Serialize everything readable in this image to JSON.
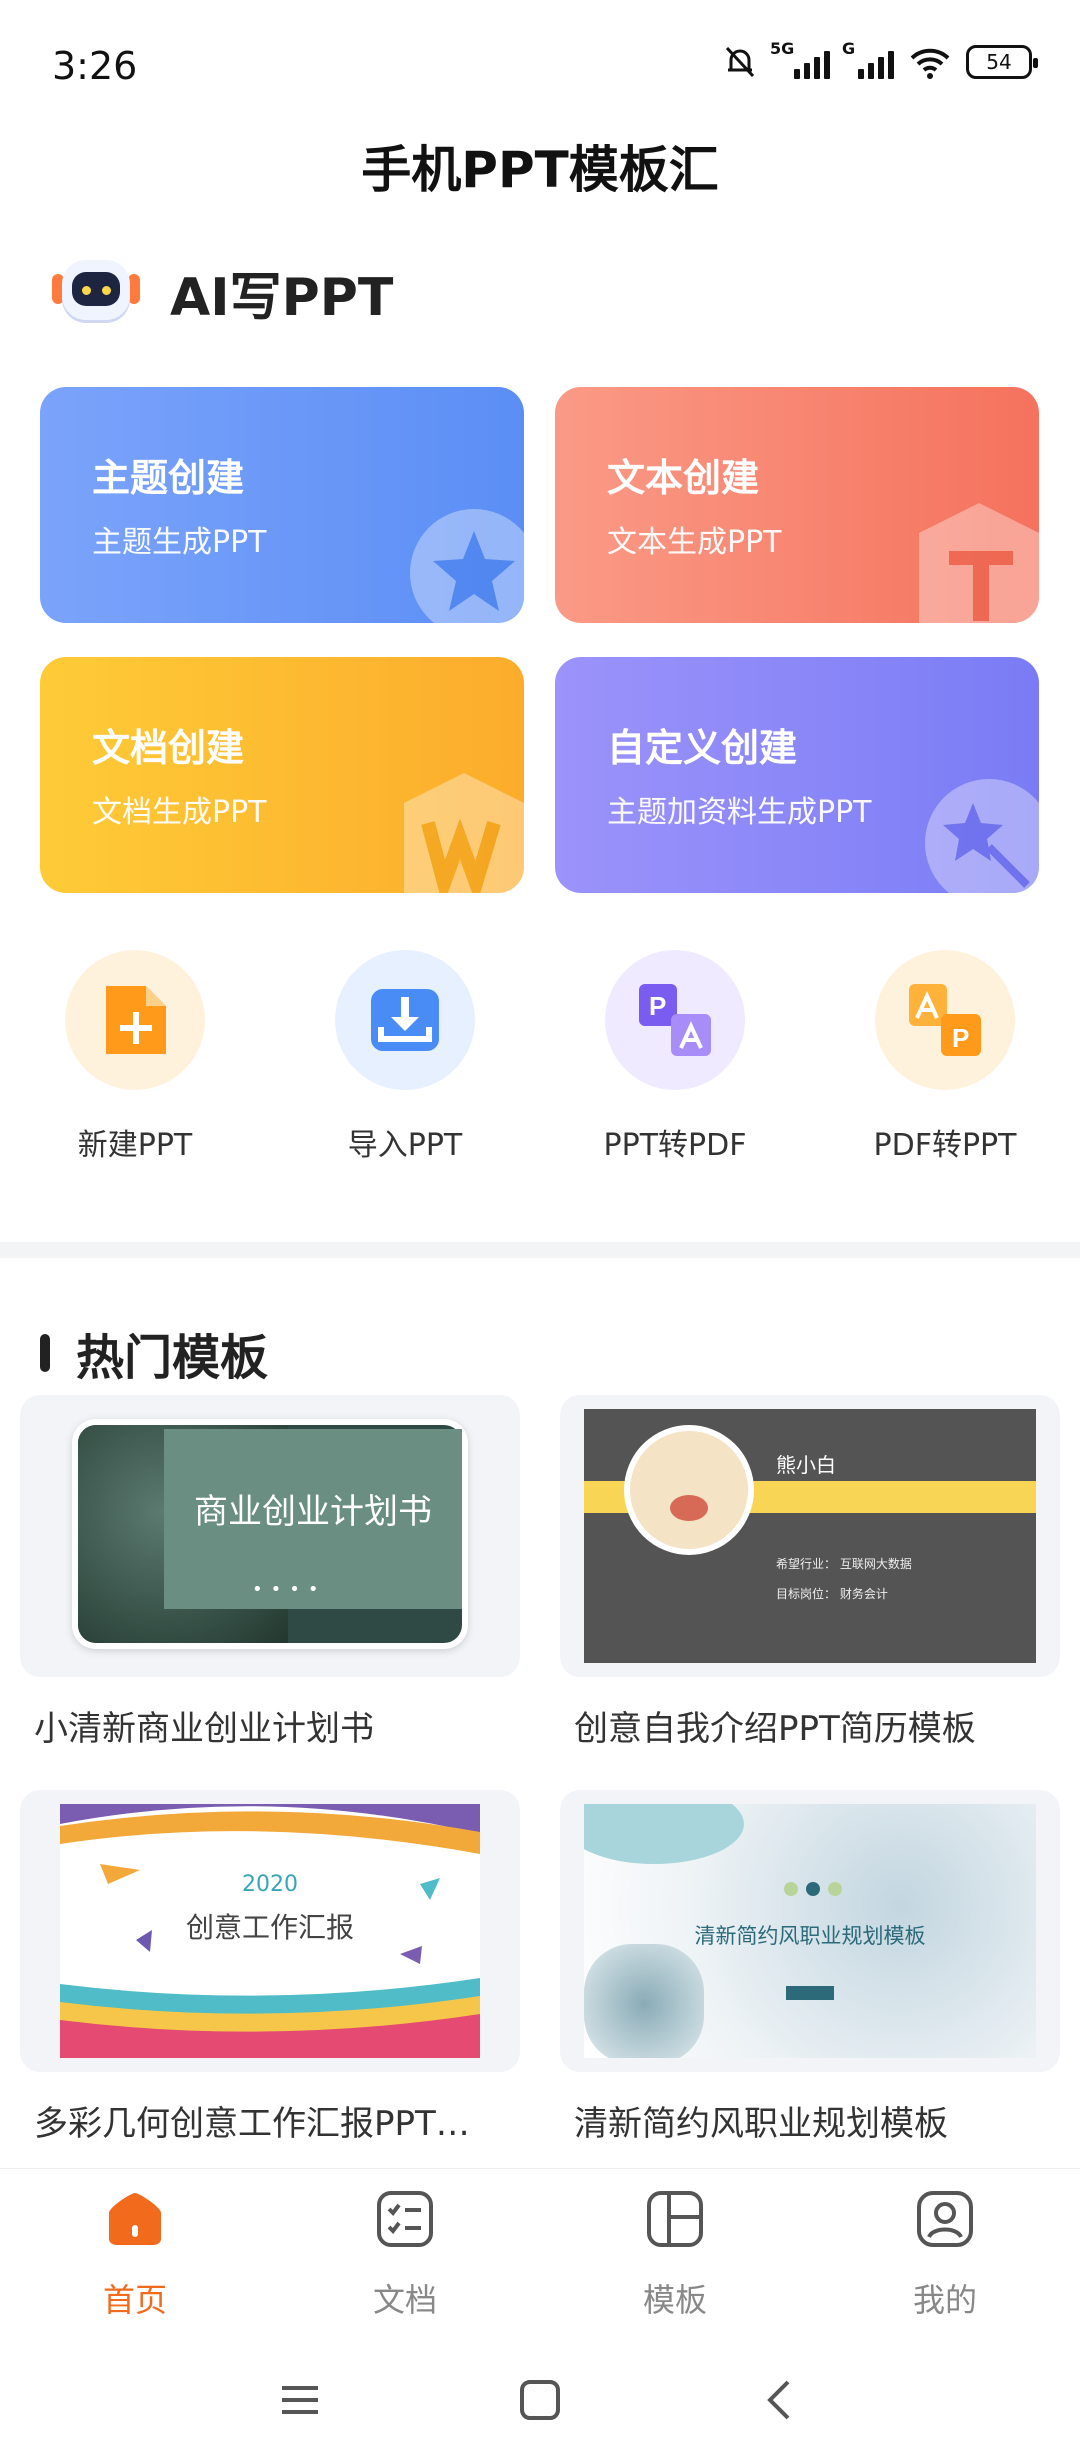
{
  "status": {
    "time": "3:26",
    "battery": "54",
    "sig1_label": "5G",
    "sig2_label": "G"
  },
  "app": {
    "title": "手机PPT模板汇"
  },
  "ai": {
    "title": "AI写PPT"
  },
  "create_cards": [
    {
      "title": "主题创建",
      "subtitle": "主题生成PPT",
      "icon": "star-icon"
    },
    {
      "title": "文本创建",
      "subtitle": "文本生成PPT",
      "icon": "text-t-icon"
    },
    {
      "title": "文档创建",
      "subtitle": "文档生成PPT",
      "icon": "word-w-icon"
    },
    {
      "title": "自定义创建",
      "subtitle": "主题加资料生成PPT",
      "icon": "magic-wand-icon"
    }
  ],
  "tools": [
    {
      "label": "新建PPT",
      "icon": "new-file-icon"
    },
    {
      "label": "导入PPT",
      "icon": "import-icon"
    },
    {
      "label": "PPT转PDF",
      "icon": "ppt-to-pdf-icon"
    },
    {
      "label": "PDF转PPT",
      "icon": "pdf-to-ppt-icon"
    }
  ],
  "hot": {
    "title": "热门模板",
    "templates": [
      {
        "name": "小清新商业创业计划书",
        "thumb_title": "商业创业计划书"
      },
      {
        "name": "创意自我介绍PPT简历模板",
        "thumb_title": "熊小白",
        "thumb_line1": "希望行业：  互联网大数据",
        "thumb_line2": "目标岗位：  财务会计"
      },
      {
        "name": "多彩几何创意工作汇报PPT…",
        "thumb_year": "2020",
        "thumb_title": "创意工作汇报"
      },
      {
        "name": "清新简约风职业规划模板",
        "thumb_title": "清新简约风职业规划模板"
      }
    ]
  },
  "nav": [
    {
      "label": "首页",
      "icon": "home-icon",
      "active": true
    },
    {
      "label": "文档",
      "icon": "document-icon",
      "active": false
    },
    {
      "label": "模板",
      "icon": "template-icon",
      "active": false
    },
    {
      "label": "我的",
      "icon": "profile-icon",
      "active": false
    }
  ],
  "colors": {
    "accent": "#f26b1d",
    "card1": "#5b8ef5",
    "card2": "#f5725d",
    "card3": "#fcac2c",
    "card4": "#7a7cf5"
  }
}
